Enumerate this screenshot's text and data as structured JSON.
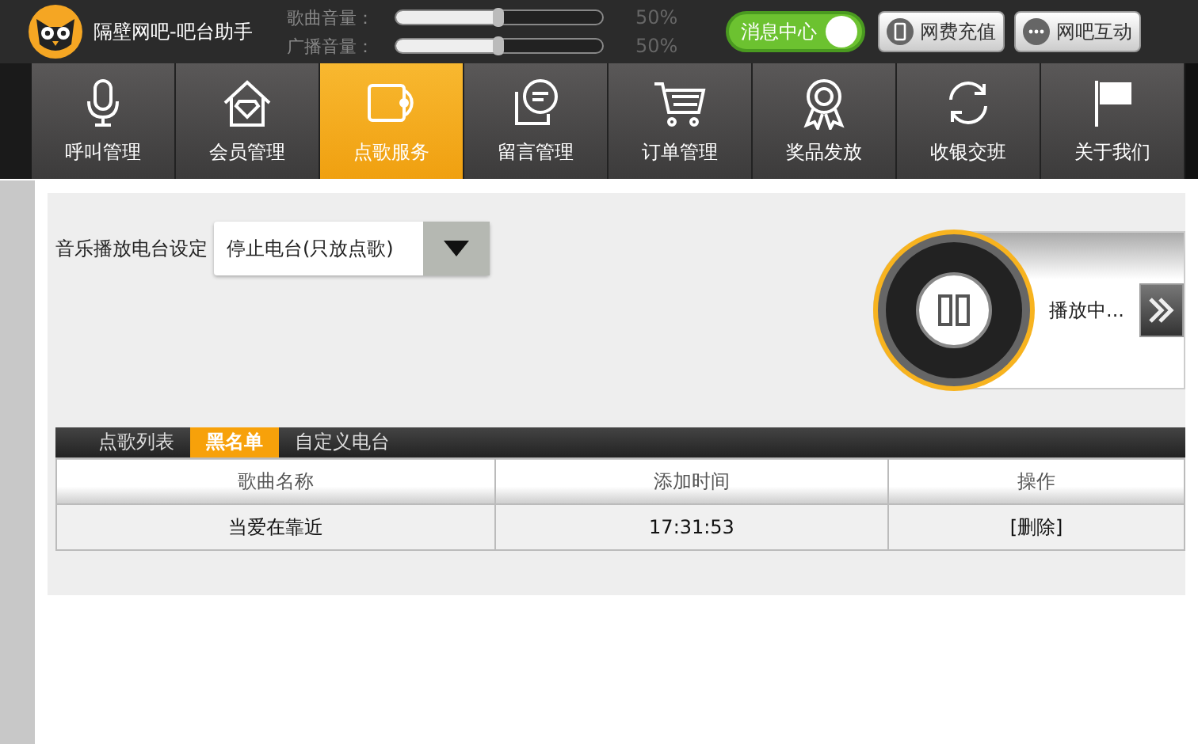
{
  "app": {
    "title": "隔壁网吧-吧台助手"
  },
  "volumes": [
    {
      "label": "歌曲音量：",
      "level": 0.5,
      "reading": "50%"
    },
    {
      "label": "广播音量：",
      "level": 0.5,
      "reading": "50%"
    }
  ],
  "message_toggle": {
    "label": "消息中心",
    "on": true
  },
  "top_buttons": [
    "网费充值",
    "网吧互动"
  ],
  "nav": [
    {
      "label": "呼叫管理",
      "selected": false
    },
    {
      "label": "会员管理",
      "selected": false
    },
    {
      "label": "点歌服务",
      "selected": true
    },
    {
      "label": "留言管理",
      "selected": false
    },
    {
      "label": "订单管理",
      "selected": false
    },
    {
      "label": "奖品发放",
      "selected": false
    },
    {
      "label": "收银交班",
      "selected": false
    },
    {
      "label": "关于我们",
      "selected": false
    }
  ],
  "radio_setting": {
    "label": "音乐播放电台设定",
    "value": "停止电台(只放点歌)"
  },
  "player": {
    "status": "播放中..."
  },
  "subtabs": [
    {
      "label": "点歌列表",
      "selected": false
    },
    {
      "label": "黑名单",
      "selected": true
    },
    {
      "label": "自定义电台",
      "selected": false
    }
  ],
  "table": {
    "columns": [
      "歌曲名称",
      "添加时间",
      "操作"
    ],
    "rows": [
      {
        "song": "当爱在靠近",
        "time": "17:31:53",
        "action": "[删除]"
      }
    ]
  }
}
